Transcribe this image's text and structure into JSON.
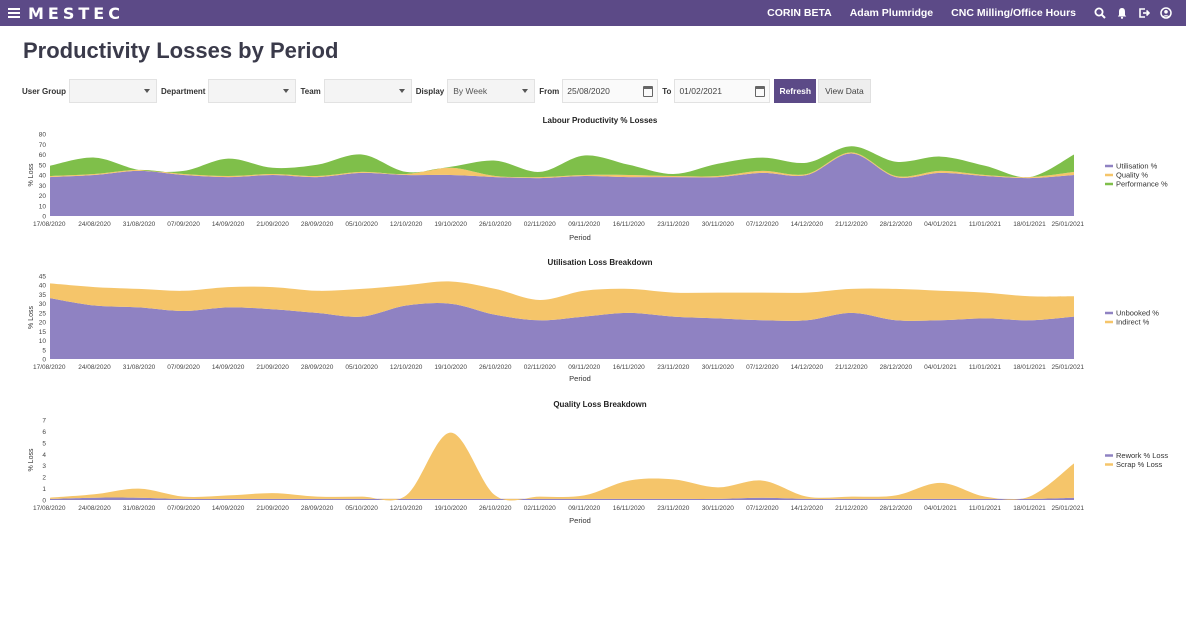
{
  "header": {
    "logo": "MESTEC",
    "site": "CORIN BETA",
    "user": "Adam Plumridge",
    "context": "CNC Milling/Office Hours"
  },
  "page": {
    "title": "Productivity Losses by Period"
  },
  "filters": {
    "user_group_label": "User Group",
    "user_group_value": "",
    "department_label": "Department",
    "department_value": "",
    "team_label": "Team",
    "team_value": "",
    "display_label": "Display",
    "display_value": "By Week",
    "from_label": "From",
    "from_value": "25/08/2020",
    "to_label": "To",
    "to_value": "01/02/2021",
    "refresh_label": "Refresh",
    "view_data_label": "View Data"
  },
  "colors": {
    "brand": "#5c4a87",
    "purple": "#8f82c2",
    "yellow": "#f5c56a",
    "green": "#7fbf4a"
  },
  "chart_data": [
    {
      "type": "area",
      "title": "Labour Productivity % Losses",
      "xlabel": "Period",
      "ylabel": "% Loss",
      "ylim": [
        0,
        80
      ],
      "yticks": [
        0,
        10,
        20,
        30,
        40,
        50,
        60,
        70,
        80
      ],
      "legend": "right",
      "categories": [
        "17/08/2020",
        "24/08/2020",
        "31/08/2020",
        "07/09/2020",
        "14/09/2020",
        "21/09/2020",
        "28/09/2020",
        "05/10/2020",
        "12/10/2020",
        "19/10/2020",
        "26/10/2020",
        "02/11/2020",
        "09/11/2020",
        "16/11/2020",
        "23/11/2020",
        "30/11/2020",
        "07/12/2020",
        "14/12/2020",
        "21/12/2020",
        "28/12/2020",
        "04/01/2021",
        "11/01/2021",
        "18/01/2021",
        "25/01/2021"
      ],
      "series": [
        {
          "name": "Utilisation %",
          "color": "#8f82c2",
          "values": [
            38,
            40,
            44,
            40,
            38,
            40,
            38,
            42,
            40,
            40,
            38,
            37,
            39,
            38,
            38,
            38,
            42,
            40,
            61,
            38,
            42,
            39,
            37,
            40
          ]
        },
        {
          "name": "Quality  %",
          "color": "#f5c56a",
          "values": [
            1,
            1,
            1,
            1,
            1,
            1,
            1,
            1,
            1,
            7,
            1,
            1,
            1,
            2,
            1,
            1,
            2,
            1,
            1,
            1,
            2,
            1,
            1,
            3
          ]
        },
        {
          "name": "Performance %",
          "color": "#7fbf4a",
          "values": [
            10,
            16,
            0,
            3,
            17,
            6,
            11,
            17,
            2,
            1,
            15,
            5,
            19,
            10,
            2,
            12,
            13,
            11,
            6,
            14,
            14,
            9,
            0,
            17
          ]
        }
      ]
    },
    {
      "type": "area",
      "title": "Utilisation Loss Breakdown",
      "xlabel": "Period",
      "ylabel": "% Loss",
      "ylim": [
        0,
        45
      ],
      "yticks": [
        0,
        5,
        10,
        15,
        20,
        25,
        30,
        35,
        40,
        45
      ],
      "legend": "right",
      "categories": [
        "17/08/2020",
        "24/08/2020",
        "31/08/2020",
        "07/09/2020",
        "14/09/2020",
        "21/09/2020",
        "28/09/2020",
        "05/10/2020",
        "12/10/2020",
        "19/10/2020",
        "26/10/2020",
        "02/11/2020",
        "09/11/2020",
        "16/11/2020",
        "23/11/2020",
        "30/11/2020",
        "07/12/2020",
        "14/12/2020",
        "21/12/2020",
        "28/12/2020",
        "04/01/2021",
        "11/01/2021",
        "18/01/2021",
        "25/01/2021"
      ],
      "series": [
        {
          "name": "Unbooked %",
          "color": "#8f82c2",
          "values": [
            33,
            29,
            28,
            26,
            28,
            27,
            25,
            23,
            29,
            30,
            24,
            21,
            23,
            25,
            23,
            22,
            21,
            21,
            25,
            21,
            21,
            22,
            21,
            23
          ]
        },
        {
          "name": "Indirect %",
          "color": "#f5c56a",
          "values": [
            8,
            10,
            10,
            11,
            11,
            12,
            12,
            15,
            11,
            12,
            14,
            11,
            14,
            13,
            13,
            14,
            15,
            15,
            13,
            17,
            16,
            14,
            13,
            11
          ]
        }
      ]
    },
    {
      "type": "area",
      "title": "Quality Loss Breakdown",
      "xlabel": "Period",
      "ylabel": "% Loss",
      "ylim": [
        0,
        7
      ],
      "yticks": [
        0,
        1,
        2,
        3,
        4,
        5,
        6,
        7
      ],
      "legend": "right",
      "categories": [
        "17/08/2020",
        "24/08/2020",
        "31/08/2020",
        "07/09/2020",
        "14/09/2020",
        "21/09/2020",
        "28/09/2020",
        "05/10/2020",
        "12/10/2020",
        "19/10/2020",
        "26/10/2020",
        "02/11/2020",
        "09/11/2020",
        "16/11/2020",
        "23/11/2020",
        "30/11/2020",
        "07/12/2020",
        "14/12/2020",
        "21/12/2020",
        "28/12/2020",
        "04/01/2021",
        "11/01/2021",
        "18/01/2021",
        "25/01/2021"
      ],
      "series": [
        {
          "name": "Rework % Loss",
          "color": "#8f82c2",
          "values": [
            0.1,
            0.2,
            0.2,
            0.1,
            0.1,
            0.1,
            0.1,
            0.1,
            0.1,
            0.1,
            0.1,
            0.1,
            0.1,
            0.1,
            0.1,
            0.1,
            0.2,
            0.1,
            0.1,
            0.1,
            0.1,
            0.1,
            0.1,
            0.2
          ]
        },
        {
          "name": "Scrap % Loss",
          "color": "#f5c56a",
          "values": [
            0.1,
            0.3,
            0.8,
            0.2,
            0.3,
            0.5,
            0.2,
            0.2,
            0.3,
            5.8,
            0.3,
            0.2,
            0.3,
            1.6,
            1.7,
            1.0,
            1.5,
            0.2,
            0.2,
            0.3,
            1.4,
            0.2,
            0.2,
            3.0
          ]
        }
      ]
    }
  ]
}
